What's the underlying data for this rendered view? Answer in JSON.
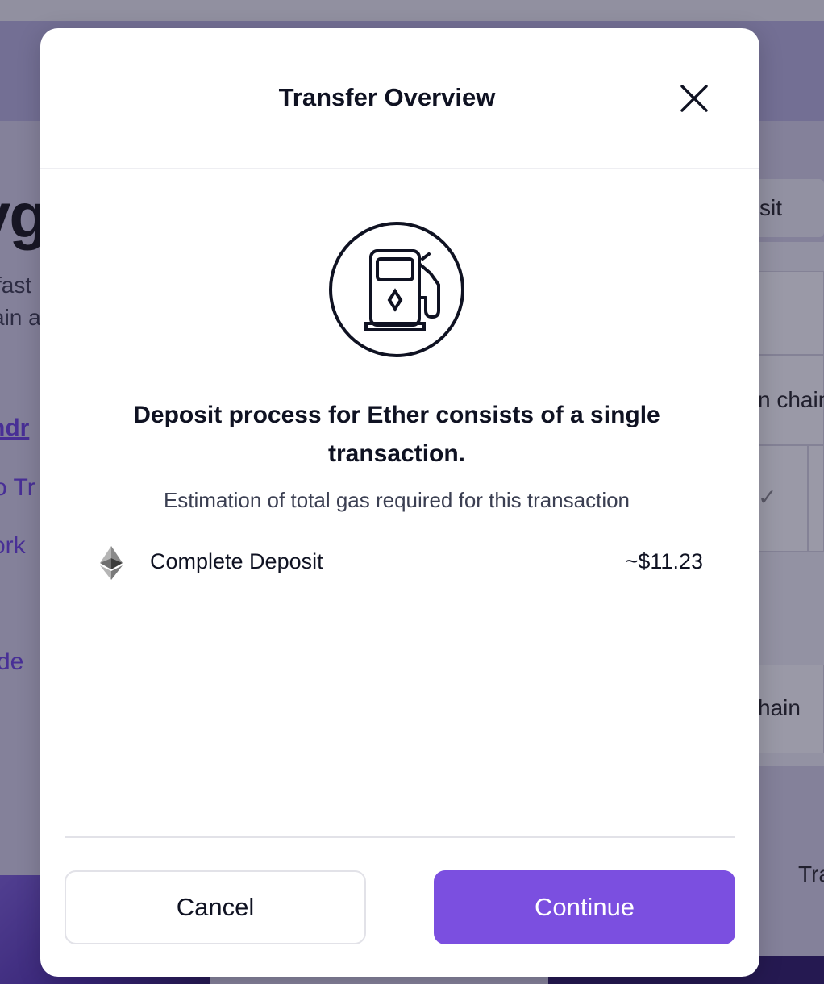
{
  "background": {
    "heading_fragment": "yg",
    "text_lines": [
      "fast",
      "ain a"
    ],
    "links": [
      "hdr",
      "o Tr",
      "ork",
      "de"
    ],
    "right_panel": [
      "sit",
      "n chain",
      "✓",
      "hain",
      "Tra"
    ]
  },
  "modal": {
    "title": "Transfer Overview",
    "close_icon": "close-icon",
    "illustration_icon": "gas-pump-icon",
    "headline": "Deposit process for Ether consists of a single transaction.",
    "subline": "Estimation of total gas required for this transaction",
    "gas_items": [
      {
        "icon": "ethereum-icon",
        "label": "Complete Deposit",
        "value": "~$11.23"
      }
    ],
    "buttons": {
      "cancel": "Cancel",
      "continue": "Continue"
    },
    "colors": {
      "primary": "#7b4fe0",
      "text": "#0f1222",
      "muted": "#3b3f52"
    }
  }
}
